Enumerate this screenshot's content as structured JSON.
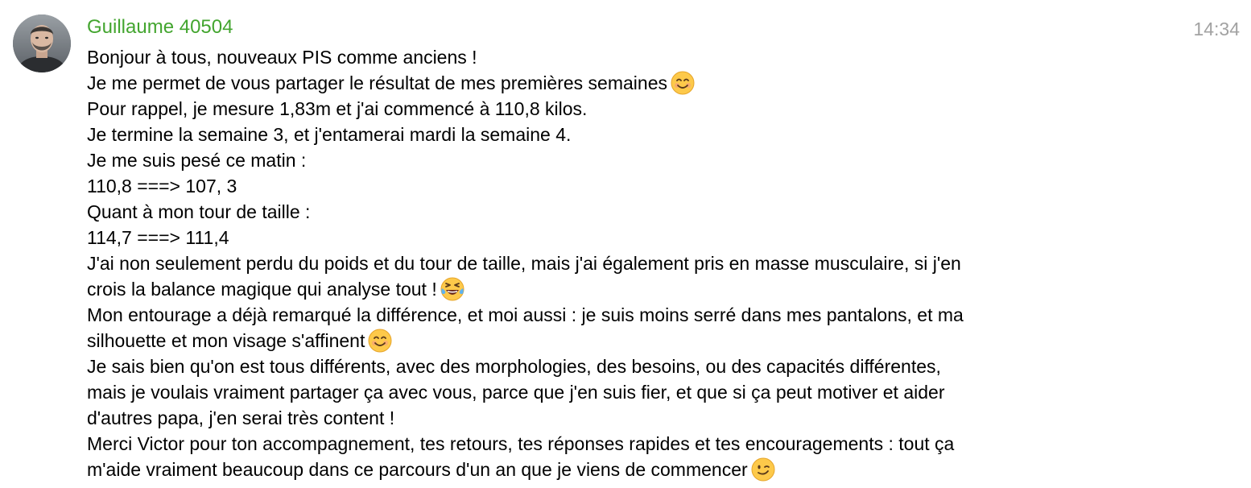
{
  "message": {
    "sender": "Guillaume 40504",
    "time": "14:34",
    "lines": [
      "Bonjour à tous, nouveaux PIS comme anciens !",
      "Je me permet de vous partager le résultat de mes premières semaines",
      "Pour rappel, je mesure 1,83m et j'ai commencé à 110,8 kilos.",
      "Je termine la semaine 3, et j'entamerai mardi la semaine 4.",
      "Je me suis pesé ce matin :",
      "110,8 ===> 107, 3",
      "Quant à mon tour de taille :",
      "114,7 ===> 111,4",
      "J'ai non seulement perdu du poids et du tour de taille, mais j'ai également pris en masse musculaire, si j'en",
      "crois la balance magique qui analyse tout !",
      "Mon entourage a déjà remarqué la différence, et moi aussi : je suis moins serré dans mes pantalons, et ma",
      "silhouette et mon visage s'affinent",
      "Je sais bien qu'on est tous différents, avec des morphologies, des besoins, ou des capacités différentes,",
      "mais je voulais vraiment partager ça avec vous, parce que j'en suis fier, et que si ça peut motiver et aider",
      "d'autres papa, j'en serai très content !",
      "Merci Victor pour ton accompagnement, tes retours, tes réponses rapides et tes encouragements : tout ça",
      "m'aide vraiment beaucoup dans ce parcours d'un an que je viens de commencer"
    ],
    "emojis": {
      "line_2": "smiling-face-emoji",
      "line_10": "tears-of-joy-emoji",
      "line_12": "smiling-face-emoji",
      "line_17": "winking-face-emoji"
    }
  },
  "colors": {
    "sender": "#43a52f",
    "timestamp": "#a2a2a2",
    "text": "#000000",
    "background": "#ffffff"
  }
}
